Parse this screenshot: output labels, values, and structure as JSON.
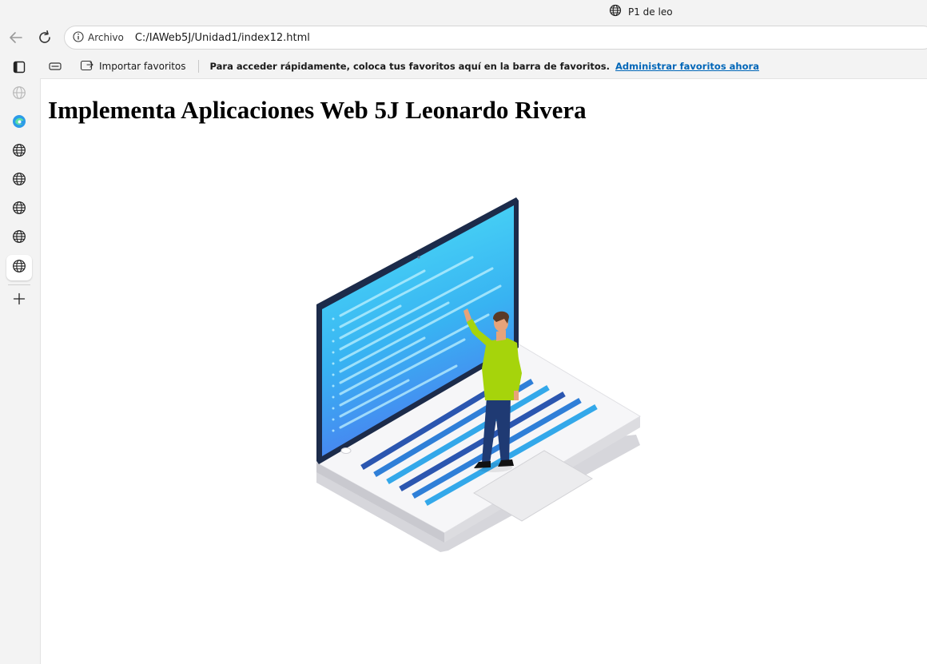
{
  "window": {
    "tab_title": "P1 de leo"
  },
  "toolbar": {
    "back_icon": "arrow-left-icon",
    "refresh_icon": "refresh-icon",
    "address": {
      "info_label": "Archivo",
      "url": "C:/IAWeb5J/Unidad1/index12.html"
    }
  },
  "favorites_bar": {
    "import_label": "Importar favoritos",
    "message": "Para acceder rápidamente, coloca tus favoritos aquí en la barra de favoritos.",
    "manage_link": "Administrar favoritos ahora"
  },
  "sidebar": {
    "items": [
      {
        "icon": "tab-actions-icon"
      },
      {
        "icon": "globe-icon"
      },
      {
        "icon": "edge-icon"
      },
      {
        "icon": "globe-icon"
      },
      {
        "icon": "globe-icon"
      },
      {
        "icon": "globe-icon"
      },
      {
        "icon": "globe-icon"
      },
      {
        "icon": "globe-icon",
        "active": true
      },
      {
        "icon": "plus-icon"
      }
    ]
  },
  "page": {
    "heading": "Implementa Aplicaciones Web 5J Leonardo Rivera",
    "image_description_icon": "laptop-developer-illustration"
  },
  "colors": {
    "link": "#0066b8",
    "screen_top": "#4fd9f5",
    "screen_bottom": "#3a8ef0",
    "shirt": "#a6d40b",
    "pants": "#1f3a73"
  }
}
